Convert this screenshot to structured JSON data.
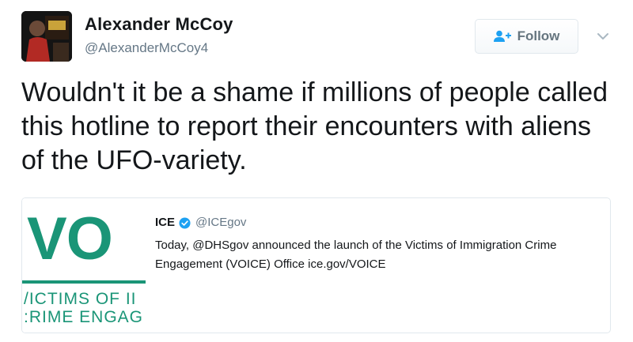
{
  "author": {
    "name": "Alexander McCoy",
    "handle": "@AlexanderMcCoy4"
  },
  "follow_button": {
    "label": "Follow",
    "icon": "add-user-icon"
  },
  "menu_icon": "chevron-down-icon",
  "tweet": {
    "text": "Wouldn't it be a shame if millions of people called this hotline to report their encounters with aliens of the UFO-variety."
  },
  "quoted_tweet": {
    "name": "ICE",
    "verified": true,
    "handle": "@ICEgov",
    "text": "Today, @DHSgov announced the launch of the Victims of Immigration Crime Engagement (VOICE) Office ice.gov/VOICE",
    "image": {
      "logo_text": "VO",
      "line1": "/ICTIMS OF II",
      "line2": ":RIME ENGAG"
    }
  },
  "colors": {
    "text": "#14171a",
    "muted": "#657786",
    "verified_blue": "#1da1f2",
    "voice_green": "#1a9577"
  }
}
